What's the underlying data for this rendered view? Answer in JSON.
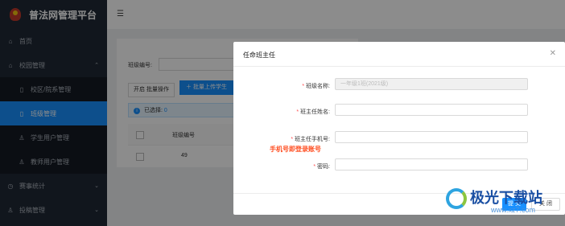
{
  "app": {
    "title": "普法网管理平台"
  },
  "sidebar": {
    "items": [
      {
        "label": "首页",
        "icon": "home-icon"
      },
      {
        "label": "校园管理",
        "icon": "home-icon"
      },
      {
        "label": "校区/院系管理",
        "icon": "document-icon"
      },
      {
        "label": "班级管理",
        "icon": "document-icon"
      },
      {
        "label": "学生用户管理",
        "icon": "user-icon"
      },
      {
        "label": "教师用户管理",
        "icon": "user-icon"
      },
      {
        "label": "赛事统计",
        "icon": "clock-icon"
      },
      {
        "label": "投稿管理",
        "icon": "user-icon"
      }
    ]
  },
  "main": {
    "filter_label": "班级编号:",
    "batch_button": "开启 批量操作",
    "upload_button": "批量上传学生",
    "selected_label": "已选择:",
    "selected_count": "0",
    "table": {
      "header": "班级编号",
      "rows": [
        {
          "code": "49"
        }
      ]
    }
  },
  "modal": {
    "title": "任命班主任",
    "fields": [
      {
        "label": "班级名称:",
        "value": "一年级1班(2021级)",
        "required": true,
        "disabled": true
      },
      {
        "label": "班主任姓名:",
        "value": "",
        "required": true
      },
      {
        "label": "班主任手机号:",
        "value": "",
        "required": true
      },
      {
        "label": "密码:",
        "value": "",
        "required": true
      }
    ],
    "hint": "手机号即登录账号",
    "submit_label": "提 交",
    "close_label": "关 闭"
  },
  "watermark": {
    "text": "极光下载站",
    "url": "www.xz7.com"
  },
  "colors": {
    "primary": "#1890ff",
    "sidebar": "#1f2936",
    "hint": "#ff4d20"
  }
}
